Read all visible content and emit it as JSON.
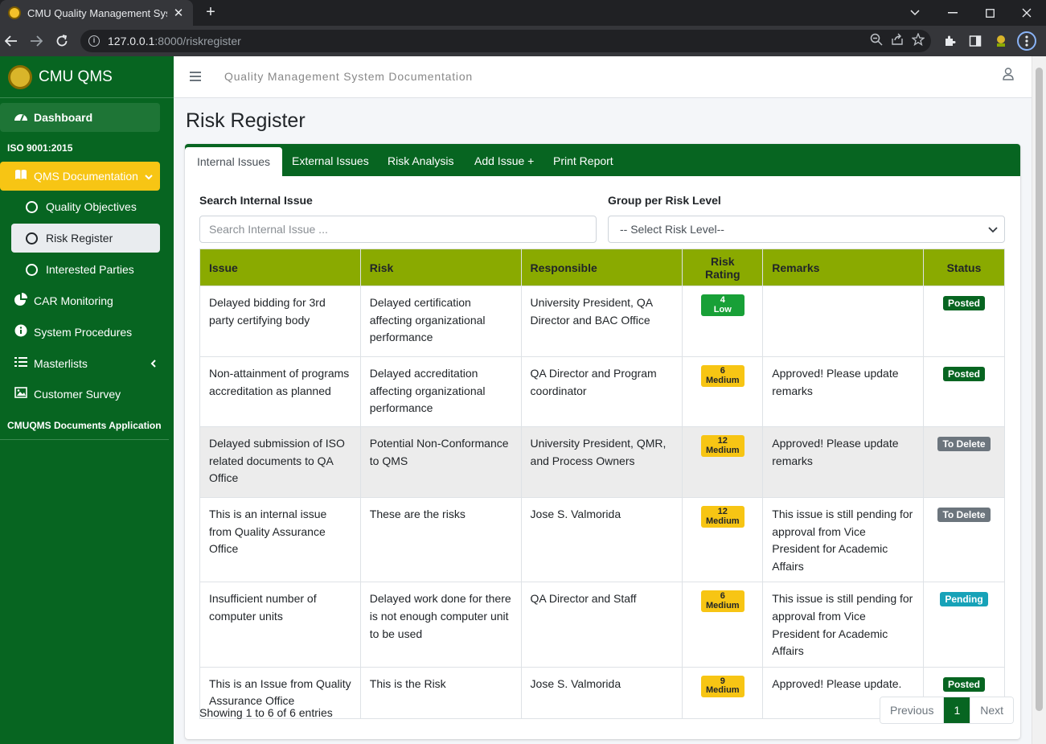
{
  "browser": {
    "tab_title": "CMU Quality Management System",
    "url_host": "127.0.0.1",
    "url_rest": ":8000/riskregister"
  },
  "sidebar": {
    "brand": "CMU QMS",
    "dashboard": "Dashboard",
    "section_iso": "ISO 9001:2015",
    "qms_documentation": "QMS Documentation",
    "sub_items": [
      "Quality Objectives",
      "Risk Register",
      "Interested Parties"
    ],
    "car_monitoring": "CAR Monitoring",
    "system_procedures": "System Procedures",
    "masterlists": "Masterlists",
    "customer_survey": "Customer Survey",
    "section_app": "CMUQMS Documents Application"
  },
  "topnav": {
    "title": "Quality Management System Documentation"
  },
  "page": {
    "title": "Risk Register",
    "tabs": [
      "Internal Issues",
      "External Issues",
      "Risk Analysis",
      "Add Issue +",
      "Print Report"
    ],
    "search_label": "Search Internal Issue",
    "search_placeholder": "Search Internal Issue ...",
    "group_label": "Group per Risk Level",
    "group_selected": "-- Select Risk Level--"
  },
  "table": {
    "headers": [
      "Issue",
      "Risk",
      "Responsible",
      "Risk Rating",
      "Remarks",
      "Status"
    ],
    "rows": [
      {
        "issue": "Delayed bidding for 3rd party certifying body",
        "risk": "Delayed certification affecting organizational performance",
        "responsible": "University President, QA Director and BAC Office",
        "rating_num": "4",
        "rating_level": "Low",
        "remarks": "",
        "status": "Posted"
      },
      {
        "issue": "Non-attainment of programs accreditation as planned",
        "risk": "Delayed accreditation affecting organizational performance",
        "responsible": "QA Director and Program coordinator",
        "rating_num": "6",
        "rating_level": "Medium",
        "remarks": "Approved! Please update remarks",
        "status": "Posted"
      },
      {
        "issue": "Delayed submission of ISO related documents to QA Office",
        "risk": "Potential Non-Conformance to QMS",
        "responsible": "University President, QMR, and Process Owners",
        "rating_num": "12",
        "rating_level": "Medium",
        "remarks": "Approved! Please update remarks",
        "status": "To Delete"
      },
      {
        "issue": "This is an internal issue from Quality Assurance Office",
        "risk": "These are the risks",
        "responsible": "Jose S. Valmorida",
        "rating_num": "12",
        "rating_level": "Medium",
        "remarks": "This issue is still pending for approval from Vice President for Academic Affairs",
        "status": "To Delete"
      },
      {
        "issue": "Insufficient number of computer units",
        "risk": "Delayed work done for there is not enough computer unit to be used",
        "responsible": "QA Director and Staff",
        "rating_num": "6",
        "rating_level": "Medium",
        "remarks": "This issue is still pending for approval from Vice President for Academic Affairs",
        "status": "Pending"
      },
      {
        "issue": "This is an Issue from Quality Assurance Office",
        "risk": "This is the Risk",
        "responsible": "Jose S. Valmorida",
        "rating_num": "9",
        "rating_level": "Medium",
        "remarks": "Approved! Please update.",
        "status": "Posted"
      }
    ],
    "info": "Showing 1 to 6 of 6 entries",
    "pager": {
      "previous": "Previous",
      "current": "1",
      "next": "Next"
    }
  },
  "colors": {
    "brand_green": "#076521",
    "header_olive": "#8aaa00",
    "accent_yellow": "#f7c514"
  }
}
